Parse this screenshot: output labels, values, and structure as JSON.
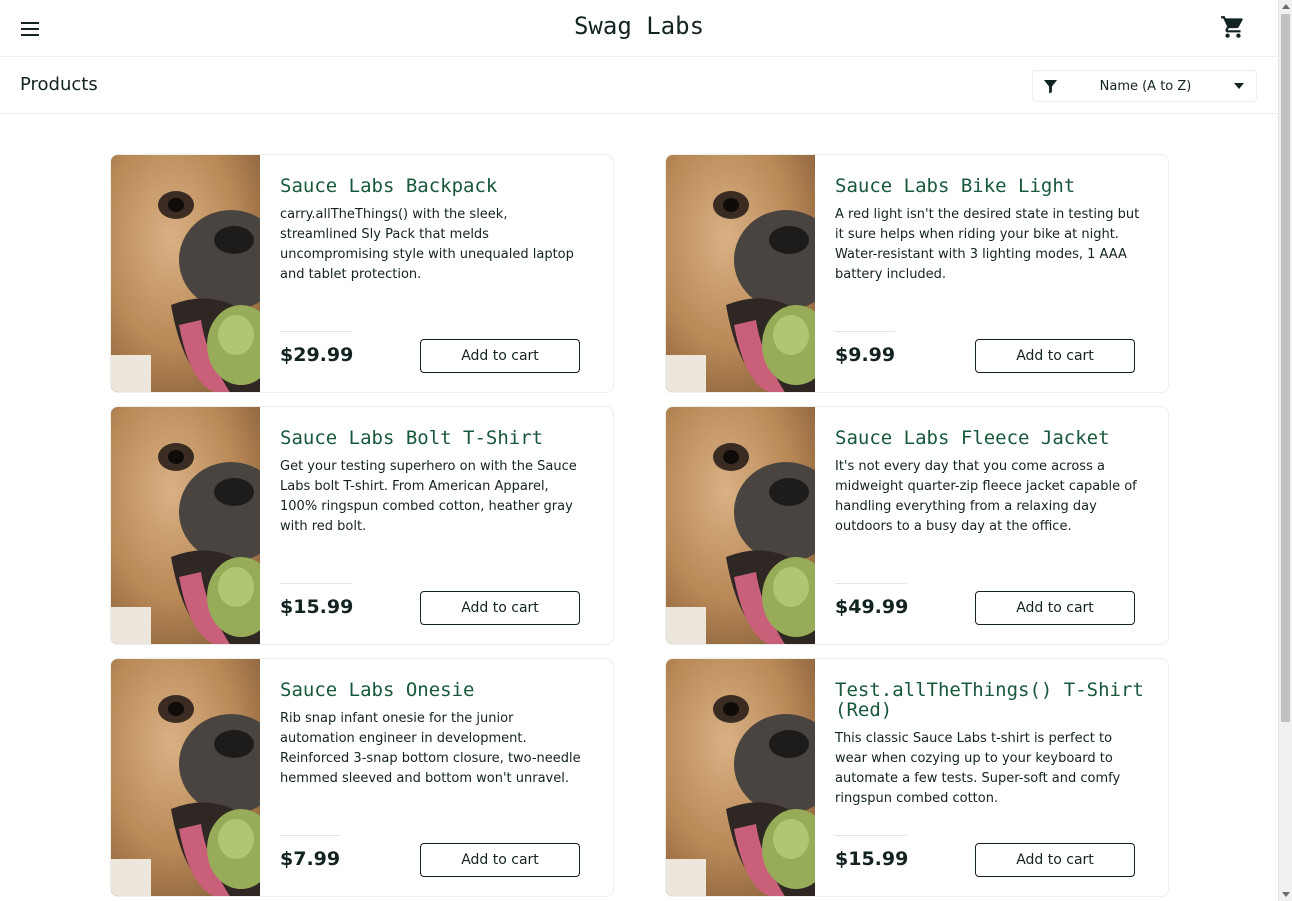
{
  "header": {
    "logo": "Swag Labs",
    "menu_icon": "hamburger-menu-icon",
    "cart_icon": "shopping-cart-icon"
  },
  "secondary_header": {
    "title": "Products",
    "sort": {
      "icon": "filter-icon",
      "selected": "Name (A to Z)"
    }
  },
  "colors": {
    "accent": "#18583a",
    "text": "#132322",
    "border": "#ededed"
  },
  "products": [
    {
      "name": "Sauce Labs Backpack",
      "description": "carry.allTheThings() with the sleek, streamlined Sly Pack that melds uncompromising style with unequaled laptop and tablet protection.",
      "price": "$29.99",
      "button": "Add to cart"
    },
    {
      "name": "Sauce Labs Bike Light",
      "description": "A red light isn't the desired state in testing but it sure helps when riding your bike at night. Water-resistant with 3 lighting modes, 1 AAA battery included.",
      "price": "$9.99",
      "button": "Add to cart"
    },
    {
      "name": "Sauce Labs Bolt T-Shirt",
      "description": "Get your testing superhero on with the Sauce Labs bolt T-shirt. From American Apparel, 100% ringspun combed cotton, heather gray with red bolt.",
      "price": "$15.99",
      "button": "Add to cart"
    },
    {
      "name": "Sauce Labs Fleece Jacket",
      "description": "It's not every day that you come across a midweight quarter-zip fleece jacket capable of handling everything from a relaxing day outdoors to a busy day at the office.",
      "price": "$49.99",
      "button": "Add to cart"
    },
    {
      "name": "Sauce Labs Onesie",
      "description": "Rib snap infant onesie for the junior automation engineer in development. Reinforced 3-snap bottom closure, two-needle hemmed sleeved and bottom won't unravel.",
      "price": "$7.99",
      "button": "Add to cart"
    },
    {
      "name": "Test.allTheThings() T-Shirt (Red)",
      "description": "This classic Sauce Labs t-shirt is perfect to wear when cozying up to your keyboard to automate a few tests. Super-soft and comfy ringspun combed cotton.",
      "price": "$15.99",
      "button": "Add to cart"
    }
  ]
}
